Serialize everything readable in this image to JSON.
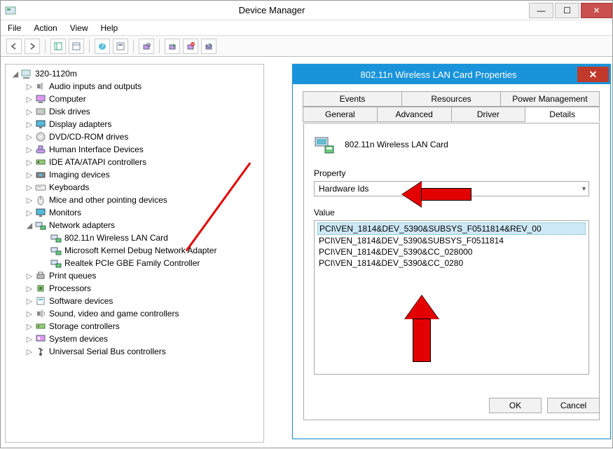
{
  "window": {
    "title": "Device Manager"
  },
  "winbtns": {
    "min": "—",
    "max": "☐",
    "close": "✕"
  },
  "menu": {
    "file": "File",
    "action": "Action",
    "view": "View",
    "help": "Help"
  },
  "tree": {
    "root": "320-1120m",
    "items": [
      "Audio inputs and outputs",
      "Computer",
      "Disk drives",
      "Display adapters",
      "DVD/CD-ROM drives",
      "Human Interface Devices",
      "IDE ATA/ATAPI controllers",
      "Imaging devices",
      "Keyboards",
      "Mice and other pointing devices",
      "Monitors",
      "Network adapters",
      "Print queues",
      "Processors",
      "Software devices",
      "Sound, video and game controllers",
      "Storage controllers",
      "System devices",
      "Universal Serial Bus controllers"
    ],
    "net_children": [
      "802.11n Wireless LAN Card",
      "Microsoft Kernel Debug Network Adapter",
      "Realtek PCIe GBE Family Controller"
    ]
  },
  "dialog": {
    "title": "802.11n Wireless LAN Card Properties",
    "device_name": "802.11n Wireless LAN Card",
    "tabs_row1": [
      "Events",
      "Resources",
      "Power Management"
    ],
    "tabs_row2": [
      "General",
      "Advanced",
      "Driver",
      "Details"
    ],
    "property_label": "Property",
    "property_value": "Hardware Ids",
    "value_label": "Value",
    "values": [
      "PCI\\VEN_1814&DEV_5390&SUBSYS_F0511814&REV_00",
      "PCI\\VEN_1814&DEV_5390&SUBSYS_F0511814",
      "PCI\\VEN_1814&DEV_5390&CC_028000",
      "PCI\\VEN_1814&DEV_5390&CC_0280"
    ],
    "ok": "OK",
    "cancel": "Cancel"
  }
}
